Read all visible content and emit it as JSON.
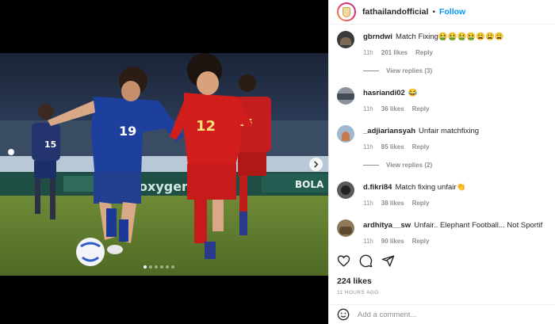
{
  "post": {
    "username": "fathailandofficial",
    "separator": "•",
    "follow_label": "Follow",
    "likes": "224 likes",
    "time_ago": "11 HOURS AGO",
    "carousel": {
      "count": 6,
      "active": 0
    }
  },
  "players": {
    "left_number": "19",
    "right_number": "12",
    "back_left_number": "15",
    "back_right_number": "15",
    "ad_text": "oxygen",
    "ad_text_right": "BOLA"
  },
  "comments": [
    {
      "user": "gbrndwi",
      "text": "Match Fixing🤮🤮🤮🤮😩😩😩",
      "time": "11h",
      "likes": "201 likes",
      "reply": "Reply",
      "view_replies": "View replies (3)"
    },
    {
      "user": "hasriandi02",
      "text": "😂",
      "time": "11h",
      "likes": "36 likes",
      "reply": "Reply"
    },
    {
      "user": "_adjiariansyah",
      "text": "Unfair matchfixing",
      "time": "11h",
      "likes": "85 likes",
      "reply": "Reply",
      "view_replies": "View replies (2)"
    },
    {
      "user": "d.fikri84",
      "text": "Match fixing unfair👏",
      "time": "11h",
      "likes": "38 likes",
      "reply": "Reply"
    },
    {
      "user": "ardhitya__sw",
      "text": "Unfair.. Elephant Football... Not Sportif",
      "time": "11h",
      "likes": "90 likes",
      "reply": "Reply"
    }
  ],
  "composer": {
    "placeholder": "Add a comment...",
    "emoji_icon": "smiley-icon"
  },
  "colors": {
    "accent": "#0095f6",
    "thai_blue": "#1d3f9e",
    "vietnam_red": "#d21d1d"
  }
}
